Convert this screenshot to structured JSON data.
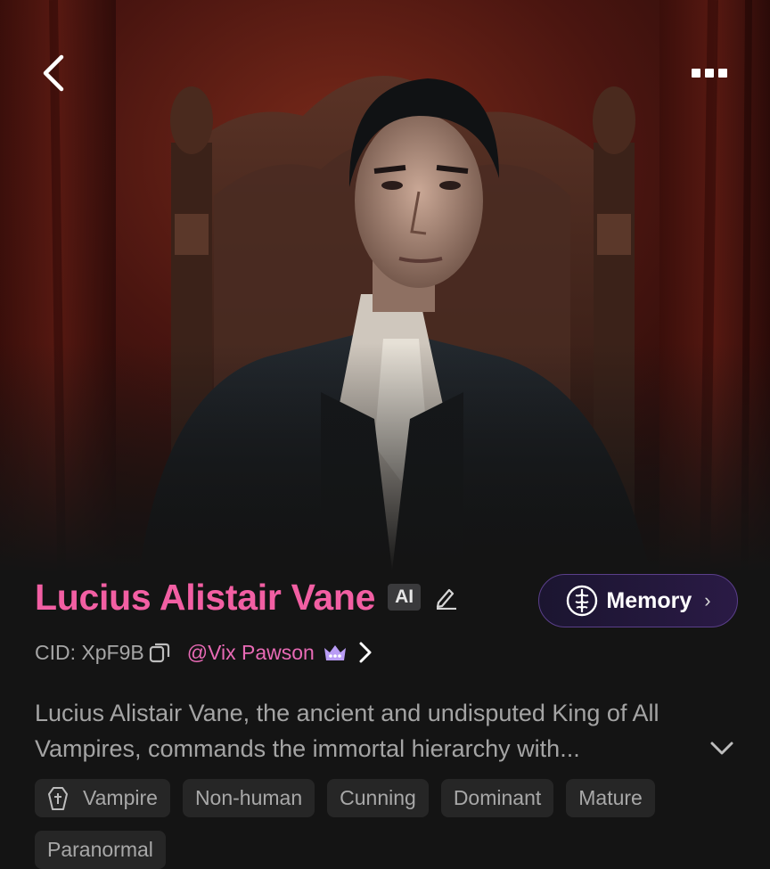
{
  "header": {
    "back_icon": "chevron-left-icon",
    "more_icon": "more-dots-icon"
  },
  "character": {
    "name": "Lucius Alistair Vane",
    "ai_badge": "AI",
    "edit_icon": "pencil-icon",
    "cid": "CID: XpF9B",
    "copy_icon": "copy-icon",
    "creator": "@Vix Pawson",
    "creator_badge_icon": "crown-icon",
    "description": "Lucius Alistair Vane, the ancient and undisputed King of All Vampires, commands the immortal hierarchy with..."
  },
  "memory_button": {
    "label": "Memory",
    "icon": "brain-icon"
  },
  "tags": [
    {
      "label": "Vampire",
      "icon": "coffin-icon"
    },
    {
      "label": "Non-human"
    },
    {
      "label": "Cunning"
    },
    {
      "label": "Dominant"
    },
    {
      "label": "Mature"
    },
    {
      "label": "Paranormal"
    }
  ],
  "colors": {
    "background": "#141414",
    "name_accent": "#f25fa3",
    "creator_accent": "#e86ab5",
    "tag_bg": "#262626",
    "memory_border": "#5a3f8a"
  }
}
